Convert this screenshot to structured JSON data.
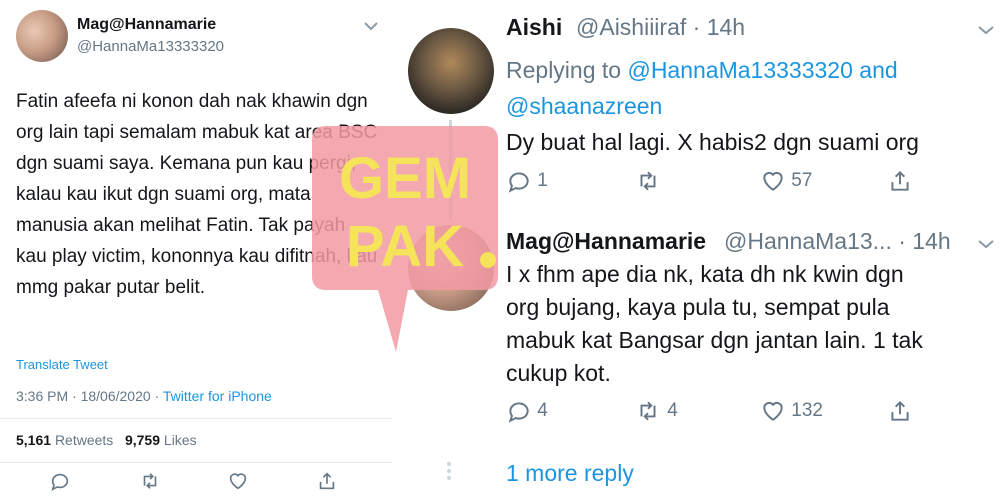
{
  "left_tweet": {
    "display_name": "Mag@Hannamarie",
    "handle": "@HannaMa13333320",
    "text": "Fatin afeefa ni konon dah nak khawin dgn org lain tapi semalam mabuk kat area BSC dgn suami saya. Kemana pun kau pergi, kalau kau ikut dgn suami org, mata manusia akan melihat Fatin. Tak payah kau play victim, kononnya kau difitnah, kau mmg pakar putar belit.",
    "translate_label": "Translate Tweet",
    "time": "3:36 PM",
    "date": "18/06/2020",
    "separator": "·",
    "source": "Twitter for iPhone",
    "retweets_count": "5,161",
    "retweets_label": "Retweets",
    "likes_count": "9,759",
    "likes_label": "Likes"
  },
  "replies": [
    {
      "display_name": "Aishi",
      "handle_time": "@Aishiiiraf · 14h",
      "replying_prefix": "Replying to",
      "replying_to_1": "@HannaMa13333320",
      "replying_and": "and",
      "replying_to_2": "@shaanazreen",
      "text": "Dy buat hal lagi. X habis2 dgn suami org",
      "reply_count": "1",
      "retweet_count": "",
      "like_count": "57"
    },
    {
      "display_name": "Mag@Hannamarie",
      "handle_time": "@HannaMa13... · 14h",
      "text_lines": [
        "I x fhm ape dia nk, kata dh nk kwin dgn",
        "org bujang, kaya pula tu, sempat pula",
        "mabuk kat Bangsar dgn jantan lain. 1 tak",
        "cukup kot."
      ],
      "reply_count": "4",
      "retweet_count": "4",
      "like_count": "132"
    }
  ],
  "more_replies_label": "1 more reply",
  "watermark": {
    "line1": "GEM",
    "line2": "PAK",
    "color": "#f29aa3",
    "text_color": "#f5e35a"
  },
  "colors": {
    "link": "#1b95e0",
    "muted": "#657786",
    "text": "#14171a",
    "divider": "#e6ecf0"
  },
  "icons": [
    "chevron-down-icon",
    "reply-icon",
    "retweet-icon",
    "like-icon",
    "share-icon"
  ]
}
